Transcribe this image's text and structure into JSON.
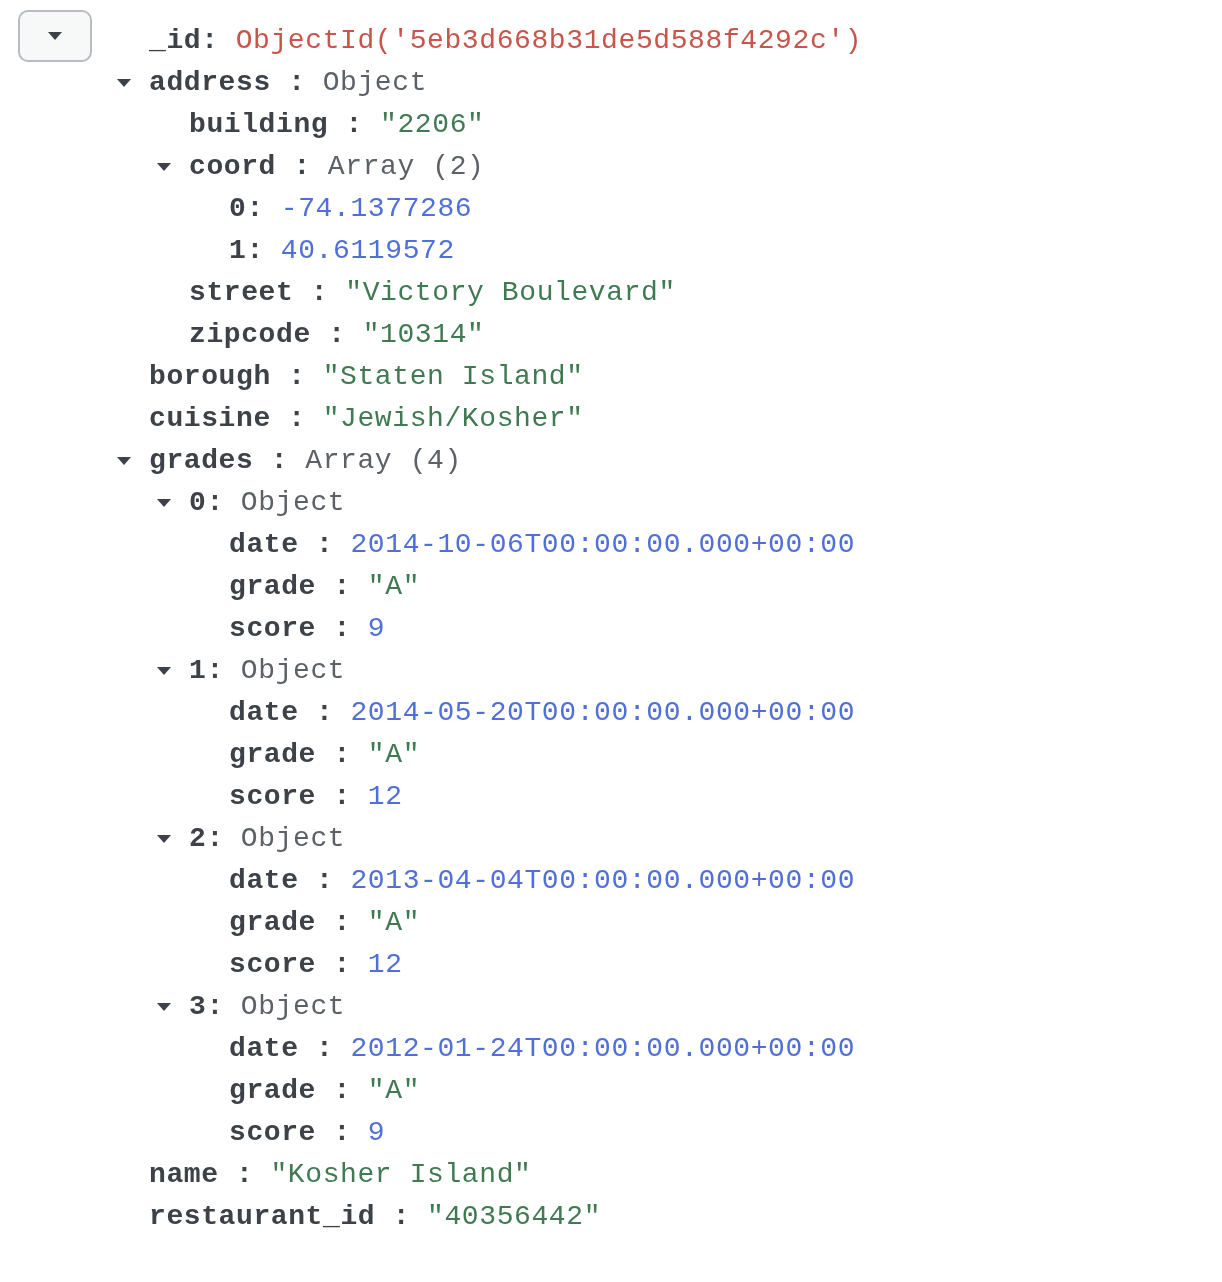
{
  "document_toggle": {
    "expanded": true
  },
  "fields": [
    {
      "key": "_id:",
      "value": "ObjectId('5eb3d668b31de5d588f4292c')",
      "kind": "objectid"
    },
    {
      "key": "address :",
      "value": "Object",
      "kind": "type",
      "expanded": true,
      "children": [
        {
          "key": "building :",
          "value": "\"2206\"",
          "kind": "string"
        },
        {
          "key": "coord :",
          "value": "Array (2)",
          "kind": "type",
          "expanded": true,
          "children": [
            {
              "key": "0:",
              "value": "-74.1377286",
              "kind": "number"
            },
            {
              "key": "1:",
              "value": "40.6119572",
              "kind": "number"
            }
          ]
        },
        {
          "key": "street :",
          "value": "\"Victory Boulevard\"",
          "kind": "string"
        },
        {
          "key": "zipcode :",
          "value": "\"10314\"",
          "kind": "string"
        }
      ]
    },
    {
      "key": "borough :",
      "value": "\"Staten Island\"",
      "kind": "string"
    },
    {
      "key": "cuisine :",
      "value": "\"Jewish/Kosher\"",
      "kind": "string"
    },
    {
      "key": "grades :",
      "value": "Array (4)",
      "kind": "type",
      "expanded": true,
      "children": [
        {
          "key": "0:",
          "value": "Object",
          "kind": "type",
          "expanded": true,
          "children": [
            {
              "key": "date :",
              "value": "2014-10-06T00:00:00.000+00:00",
              "kind": "number"
            },
            {
              "key": "grade :",
              "value": "\"A\"",
              "kind": "string"
            },
            {
              "key": "score :",
              "value": "9",
              "kind": "number"
            }
          ]
        },
        {
          "key": "1:",
          "value": "Object",
          "kind": "type",
          "expanded": true,
          "children": [
            {
              "key": "date :",
              "value": "2014-05-20T00:00:00.000+00:00",
              "kind": "number"
            },
            {
              "key": "grade :",
              "value": "\"A\"",
              "kind": "string"
            },
            {
              "key": "score :",
              "value": "12",
              "kind": "number"
            }
          ]
        },
        {
          "key": "2:",
          "value": "Object",
          "kind": "type",
          "expanded": true,
          "children": [
            {
              "key": "date :",
              "value": "2013-04-04T00:00:00.000+00:00",
              "kind": "number"
            },
            {
              "key": "grade :",
              "value": "\"A\"",
              "kind": "string"
            },
            {
              "key": "score :",
              "value": "12",
              "kind": "number"
            }
          ]
        },
        {
          "key": "3:",
          "value": "Object",
          "kind": "type",
          "expanded": true,
          "children": [
            {
              "key": "date :",
              "value": "2012-01-24T00:00:00.000+00:00",
              "kind": "number"
            },
            {
              "key": "grade :",
              "value": "\"A\"",
              "kind": "string"
            },
            {
              "key": "score :",
              "value": "9",
              "kind": "number"
            }
          ]
        }
      ]
    },
    {
      "key": "name :",
      "value": "\"Kosher Island\"",
      "kind": "string"
    },
    {
      "key": "restaurant_id :",
      "value": "\"40356442\"",
      "kind": "string"
    }
  ]
}
